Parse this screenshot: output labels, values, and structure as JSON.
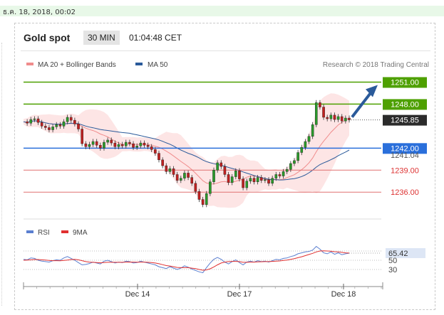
{
  "timestamp": "ธ.ค. 18, 2018, 00:02",
  "header": {
    "title": "Gold spot",
    "interval": "30 MIN",
    "countdown": "01:04:48 CET"
  },
  "chart_data": {
    "type": "line",
    "legend": [
      {
        "name": "MA 20 + Bollinger Bands",
        "color": "#f08c8c"
      },
      {
        "name": "MA 50",
        "color": "#2a5a9a"
      }
    ],
    "credit": "Research © 2018 Trading Central",
    "x_ticks": [
      "Dec 14",
      "Dec 17",
      "Dec 18"
    ],
    "ylim": [
      1233.5,
      1252.5
    ],
    "levels": [
      {
        "value": 1251.0,
        "label": "1251.00",
        "kind": "resistance",
        "color": "#4ea000"
      },
      {
        "value": 1248.0,
        "label": "1248.00",
        "kind": "resistance",
        "color": "#4ea000"
      },
      {
        "value": 1242.0,
        "label": "1242.00",
        "kind": "pivot",
        "color": "#2a6fdb"
      },
      {
        "value": 1239.0,
        "label": "1239.00",
        "kind": "support",
        "color": "#e07070"
      },
      {
        "value": 1236.0,
        "label": "1236.00",
        "kind": "support",
        "color": "#e07070"
      }
    ],
    "last_price": {
      "value": 1245.85,
      "label": "1245.85"
    },
    "ma50_last": {
      "value": 1241.04,
      "label": "1241.04"
    },
    "price": [
      1245.6,
      1245.4,
      1245.9,
      1246.0,
      1245.5,
      1245.0,
      1244.8,
      1244.5,
      1244.9,
      1245.2,
      1245.0,
      1245.6,
      1246.2,
      1245.8,
      1245.3,
      1244.6,
      1242.6,
      1242.2,
      1242.5,
      1242.9,
      1242.4,
      1242.0,
      1242.8,
      1243.1,
      1242.7,
      1242.2,
      1242.5,
      1242.3,
      1242.8,
      1242.6,
      1242.1,
      1242.3,
      1242.7,
      1242.4,
      1242.2,
      1241.8,
      1241.3,
      1240.4,
      1239.6,
      1238.8,
      1239.2,
      1238.4,
      1237.6,
      1237.9,
      1238.6,
      1238.0,
      1237.2,
      1236.1,
      1235.0,
      1234.3,
      1235.8,
      1237.4,
      1239.0,
      1240.0,
      1239.5,
      1238.4,
      1237.3,
      1238.1,
      1238.9,
      1237.8,
      1236.6,
      1237.5,
      1237.9,
      1237.4,
      1238.0,
      1237.6,
      1237.7,
      1237.2,
      1237.9,
      1238.4,
      1238.2,
      1238.8,
      1239.1,
      1239.9,
      1240.3,
      1241.4,
      1242.1,
      1242.9,
      1243.6,
      1245.2,
      1248.2,
      1247.6,
      1246.2,
      1246.0,
      1246.5,
      1245.9,
      1246.3,
      1245.7,
      1246.1,
      1245.85
    ],
    "rsi": [
      52,
      51,
      55,
      54,
      50,
      48,
      47,
      46,
      49,
      51,
      50,
      55,
      58,
      54,
      50,
      45,
      40,
      41,
      43,
      46,
      44,
      42,
      48,
      50,
      47,
      44,
      46,
      45,
      48,
      47,
      44,
      45,
      48,
      46,
      44,
      42,
      40,
      36,
      34,
      32,
      36,
      33,
      30,
      33,
      38,
      35,
      31,
      28,
      25,
      23,
      34,
      44,
      52,
      56,
      52,
      46,
      42,
      47,
      51,
      45,
      40,
      46,
      48,
      46,
      49,
      47,
      48,
      46,
      49,
      52,
      51,
      54,
      55,
      58,
      60,
      64,
      66,
      68,
      69,
      72,
      80,
      74,
      66,
      64,
      68,
      63,
      66,
      62,
      64,
      65.42
    ],
    "rsi_ma": [
      50,
      50.5,
      51,
      51.5,
      51.5,
      51,
      50.5,
      49.5,
      49,
      49,
      48.8,
      49.5,
      50.5,
      51.5,
      52,
      51,
      49,
      47,
      46,
      45.5,
      45,
      44.5,
      45,
      45.5,
      45.5,
      45.5,
      45.5,
      45.5,
      46,
      46.2,
      46,
      45.8,
      46,
      46,
      45.5,
      45,
      44,
      42.5,
      40.5,
      38.5,
      37.5,
      36,
      34.5,
      34,
      34,
      34,
      33,
      32,
      30,
      28.5,
      29,
      31.5,
      35.5,
      40,
      44,
      46,
      47,
      47.5,
      47.5,
      47,
      45.5,
      45.5,
      46,
      46,
      46.5,
      46.8,
      47,
      47,
      47.5,
      48,
      48.5,
      49.5,
      50.5,
      52,
      53.5,
      55.5,
      57.5,
      60,
      62.5,
      65,
      68,
      70,
      70.5,
      70,
      69.5,
      68.5,
      68,
      67,
      66,
      65.6
    ],
    "rsi_legend": [
      {
        "name": "RSI",
        "color": "#5b7fd0"
      },
      {
        "name": "9MA",
        "color": "#e03030"
      }
    ],
    "rsi_ticks": [
      "65.42",
      "50",
      "30"
    ],
    "rsi_ylim": [
      10,
      90
    ]
  }
}
